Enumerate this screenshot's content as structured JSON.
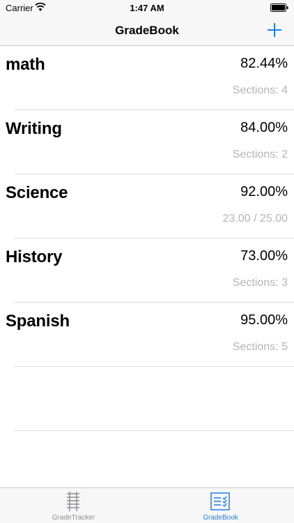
{
  "status_bar": {
    "carrier": "Carrier",
    "time": "1:47 AM",
    "icons": [
      "wifi-icon",
      "battery-icon"
    ]
  },
  "nav_bar": {
    "title": "GradeBook",
    "add_icon": "plus-icon",
    "accent_color": "#1a7ef5"
  },
  "courses": [
    {
      "name": "math",
      "grade": "82.44%",
      "detail": "Sections: 4"
    },
    {
      "name": "Writing",
      "grade": "84.00%",
      "detail": "Sections: 2"
    },
    {
      "name": "Science",
      "grade": "92.00%",
      "detail": "23.00 / 25.00"
    },
    {
      "name": "History",
      "grade": "73.00%",
      "detail": "Sections: 3"
    },
    {
      "name": "Spanish",
      "grade": "95.00%",
      "detail": "Sections: 5"
    }
  ],
  "tab_bar": {
    "tabs": [
      {
        "label": "GradeTracker",
        "icon": "rail-track-icon",
        "selected": false
      },
      {
        "label": "GradeBook",
        "icon": "checklist-icon",
        "selected": true
      }
    ]
  }
}
